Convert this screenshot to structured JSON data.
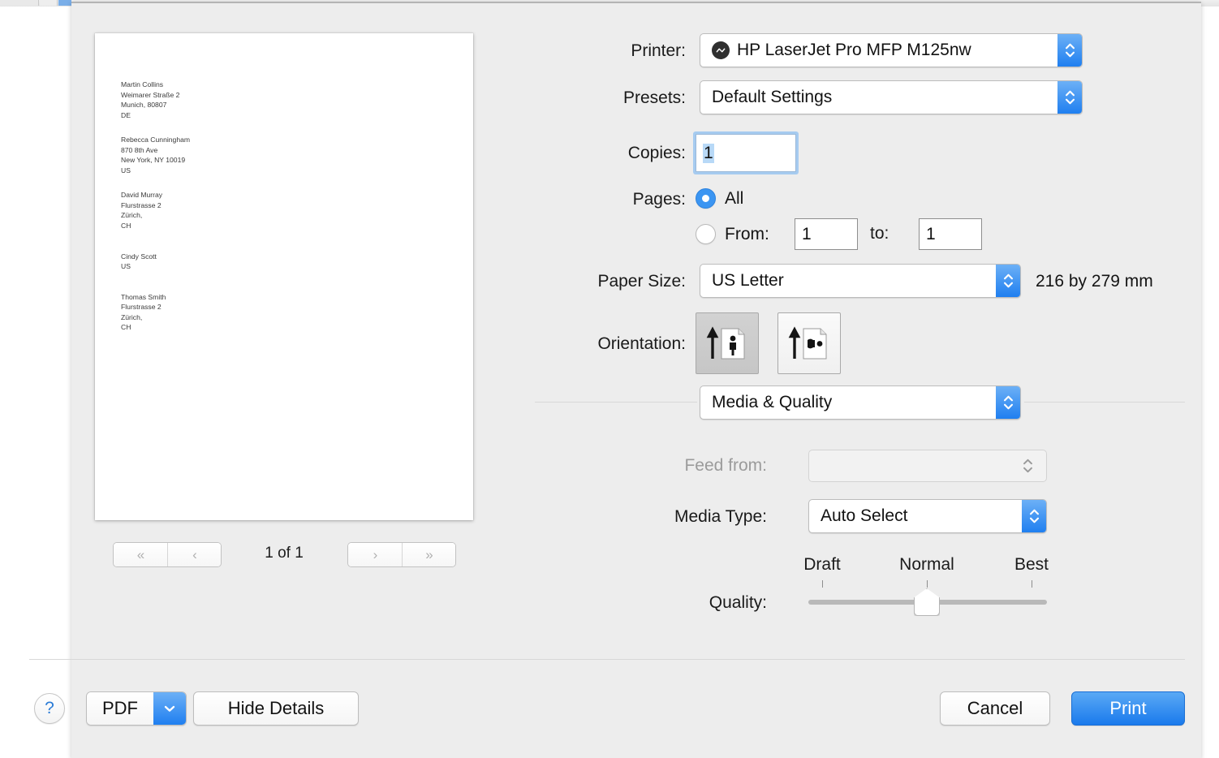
{
  "dialog": {
    "type": "print-dialog"
  },
  "preview": {
    "document_blocks": [
      [
        "Martin Collins",
        "Weimarer Straße 2",
        "Munich, 80807",
        "DE"
      ],
      [
        "Rebecca Cunningham",
        "870 8th Ave",
        "New York, NY 10019",
        "US"
      ],
      [
        "David Murray",
        "Flurstrasse 2",
        "Zürich,",
        "CH"
      ],
      [
        "Cindy Scott",
        "US"
      ],
      [
        "Thomas Smith",
        "Flurstrasse 2",
        "Zürich,",
        "CH"
      ]
    ],
    "nav": {
      "first_label": "«",
      "prev_label": "‹",
      "next_label": "›",
      "last_label": "»",
      "page_indicator": "1 of 1"
    }
  },
  "settings": {
    "printer": {
      "label": "Printer:",
      "value": "HP LaserJet Pro MFP M125nw",
      "icon": "printer-status-icon"
    },
    "presets": {
      "label": "Presets:",
      "value": "Default Settings"
    },
    "copies": {
      "label": "Copies:",
      "value": "1"
    },
    "pages": {
      "label": "Pages:",
      "all_label": "All",
      "all_selected": true,
      "from_label": "From:",
      "from_value": "1",
      "to_label": "to:",
      "to_value": "1"
    },
    "paper_size": {
      "label": "Paper Size:",
      "value": "US Letter",
      "dimensions": "216 by 279 mm"
    },
    "orientation": {
      "label": "Orientation:",
      "portrait_selected": true,
      "options": [
        "portrait",
        "landscape"
      ]
    },
    "pane": {
      "value": "Media & Quality"
    },
    "feed_from": {
      "label": "Feed from:",
      "value": "",
      "disabled": true
    },
    "media_type": {
      "label": "Media Type:",
      "value": "Auto Select"
    },
    "quality": {
      "label": "Quality:",
      "ticks": [
        "Draft",
        "Normal",
        "Best"
      ],
      "value": "Normal"
    }
  },
  "footer": {
    "help_label": "?",
    "pdf_label": "PDF",
    "hide_details_label": "Hide Details",
    "cancel_label": "Cancel",
    "print_label": "Print"
  },
  "colors": {
    "accent_blue": "#1f7ff0",
    "dialog_bg": "#ededed",
    "print_button": "#1a7aec"
  }
}
